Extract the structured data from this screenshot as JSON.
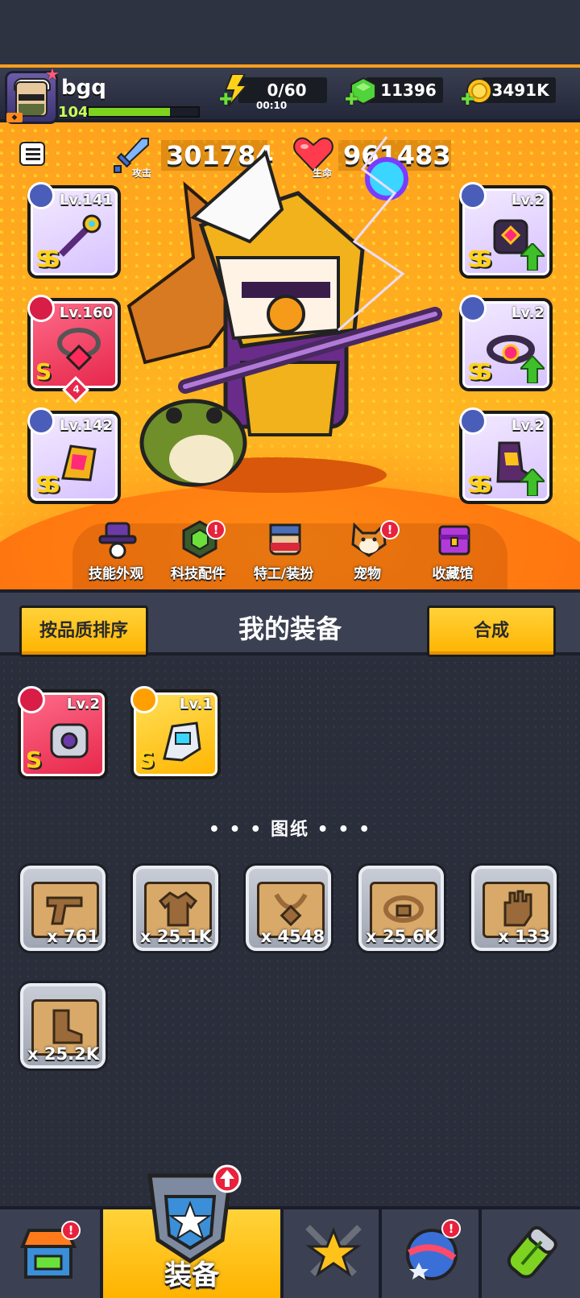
{
  "player": {
    "name": "bgq",
    "level": "104",
    "xp_fraction": 0.74
  },
  "resources": {
    "energy": {
      "value": "0/60",
      "timer": "00:10"
    },
    "gems": {
      "value": "11396"
    },
    "coins": {
      "value": "3491K"
    }
  },
  "stats": {
    "attack": {
      "label": "攻击",
      "value": "301784"
    },
    "health": {
      "label": "生命",
      "value": "961483"
    }
  },
  "equipped": {
    "left": [
      {
        "level": "Lv.141",
        "rank": "SS",
        "slot": "weapon",
        "color": "purple"
      },
      {
        "level": "Lv.160",
        "rank": "S",
        "slot": "necklace",
        "color": "red",
        "stars": "4"
      },
      {
        "level": "Lv.142",
        "rank": "SS",
        "slot": "glove",
        "color": "purple"
      }
    ],
    "right": [
      {
        "level": "Lv.2",
        "rank": "SS",
        "slot": "armor",
        "color": "purple",
        "upgradable": true
      },
      {
        "level": "Lv.2",
        "rank": "SS",
        "slot": "belt",
        "color": "purple",
        "upgradable": true
      },
      {
        "level": "Lv.2",
        "rank": "SS",
        "slot": "boots",
        "color": "purple",
        "upgradable": true
      }
    ]
  },
  "features": [
    {
      "label": "技能外观",
      "icon": "wizard-hat-icon",
      "notify": false
    },
    {
      "label": "科技配件",
      "icon": "tech-chip-icon",
      "notify": true
    },
    {
      "label": "特工/装扮",
      "icon": "agent-face-icon",
      "notify": false
    },
    {
      "label": "宠物",
      "icon": "pet-dog-icon",
      "notify": true
    },
    {
      "label": "收藏馆",
      "icon": "treasure-chest-icon",
      "notify": false
    }
  ],
  "equip_section": {
    "sort_label": "按品质排序",
    "title": "我的装备",
    "merge_label": "合成"
  },
  "inventory": [
    {
      "level": "Lv.2",
      "rank": "S",
      "slot": "armor",
      "color": "red"
    },
    {
      "level": "Lv.1",
      "rank": "S",
      "slot": "glove",
      "color": "gold"
    }
  ],
  "blueprints": {
    "title": "• • •   图纸   • • •",
    "items": [
      {
        "count": "x 761",
        "icon": "pistol-icon"
      },
      {
        "count": "x 25.1K",
        "icon": "shirt-icon"
      },
      {
        "count": "x 4548",
        "icon": "necklace-icon"
      },
      {
        "count": "x 25.6K",
        "icon": "belt-icon"
      },
      {
        "count": "x 133",
        "icon": "glove-icon"
      },
      {
        "count": "x 25.2K",
        "icon": "boot-icon"
      }
    ]
  },
  "bottom_nav": {
    "shop": {
      "icon": "shop-icon",
      "notify": true
    },
    "equip": {
      "label": "装备",
      "icon": "equipment-icon",
      "upgrade": true
    },
    "battle": {
      "icon": "crossed-swords-star-icon"
    },
    "world": {
      "icon": "planet-icon",
      "notify": true
    },
    "evolve": {
      "icon": "dna-capsule-icon"
    }
  },
  "colors": {
    "accent": "#ffc21a",
    "bg": "#2b2f3d",
    "green_arrow": "#3fbf2a",
    "notify_red": "#e8213d"
  }
}
